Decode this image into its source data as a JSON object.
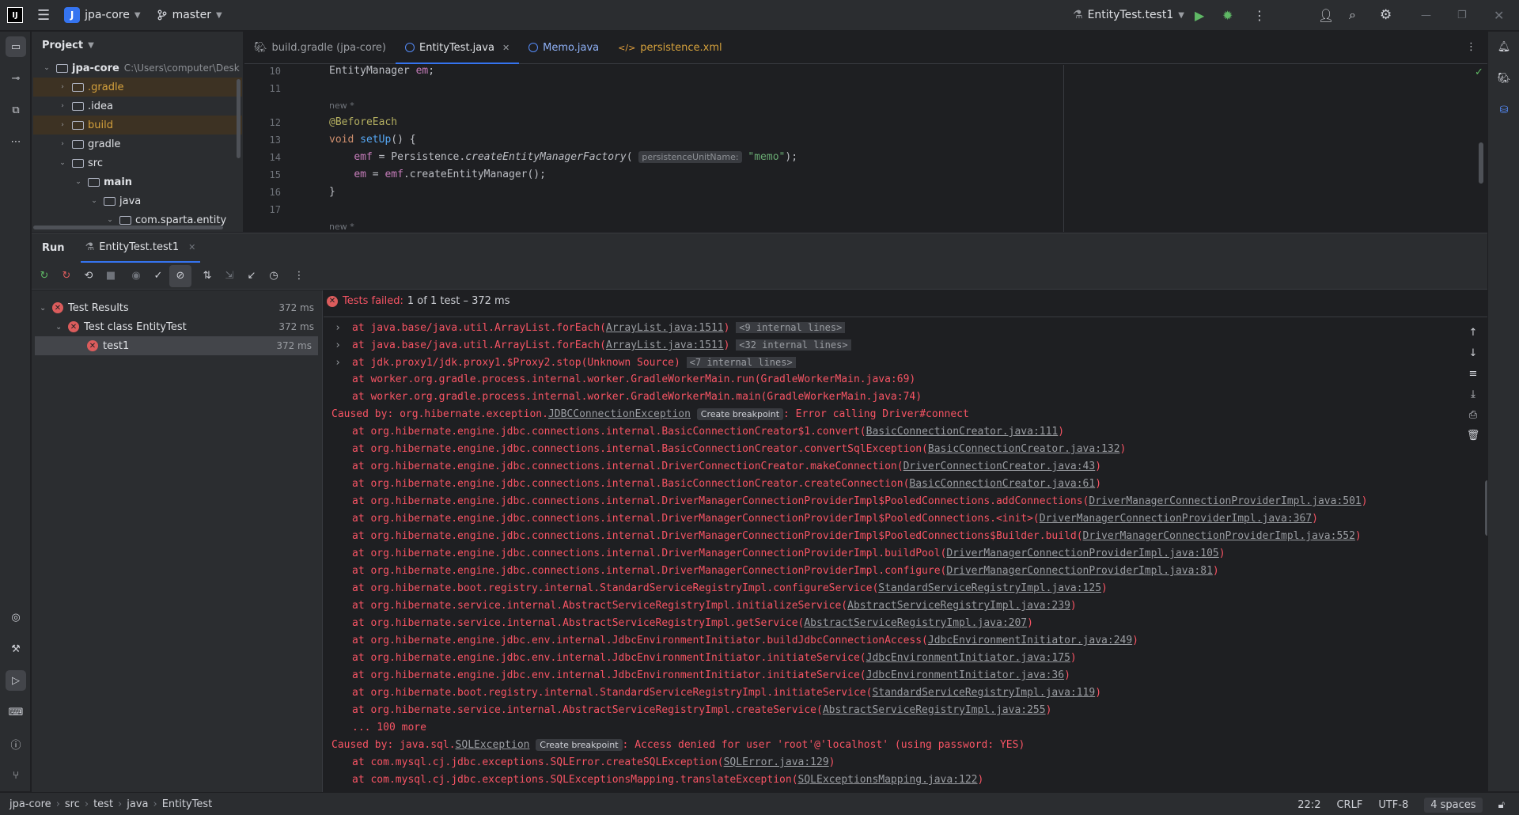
{
  "topbar": {
    "project_initial": "J",
    "project": "jpa-core",
    "branch": "master",
    "run_config": "EntityTest.test1"
  },
  "project_panel": {
    "title": "Project",
    "items": [
      {
        "label": "jpa-core",
        "path": "C:\\Users\\computer\\Desk",
        "indent": 0,
        "open": true,
        "color": "#dfe1e5",
        "bold": true
      },
      {
        "label": ".gradle",
        "indent": 1,
        "open": false,
        "color": "#d5a13c",
        "excluded": true
      },
      {
        "label": ".idea",
        "indent": 1,
        "open": false,
        "color": "#dfe1e5"
      },
      {
        "label": "build",
        "indent": 1,
        "open": false,
        "color": "#d5a13c",
        "excluded": true
      },
      {
        "label": "gradle",
        "indent": 1,
        "open": false,
        "color": "#dfe1e5"
      },
      {
        "label": "src",
        "indent": 1,
        "open": true,
        "color": "#dfe1e5"
      },
      {
        "label": "main",
        "indent": 2,
        "open": true,
        "color": "#dfe1e5",
        "bold": true
      },
      {
        "label": "java",
        "indent": 3,
        "open": true,
        "color": "#dfe1e5"
      },
      {
        "label": "com.sparta.entity",
        "indent": 4,
        "open": true,
        "color": "#dfe1e5"
      }
    ]
  },
  "editor": {
    "tabs": [
      {
        "label": "build.gradle (jpa-core)",
        "icon": "gradle-icon",
        "active": false
      },
      {
        "label": "EntityTest.java",
        "icon": "class-icon",
        "active": true,
        "closable": true
      },
      {
        "label": "Memo.java",
        "icon": "class-icon",
        "active": false
      },
      {
        "label": "persistence.xml",
        "icon": "xml-icon",
        "active": false
      }
    ],
    "hint_label": "persistenceUnitName:",
    "new_marker": "new *",
    "line_numbers": [
      "10",
      "11",
      "12",
      "13",
      "14",
      "15",
      "16",
      "17"
    ]
  },
  "run": {
    "tab_run": "Run",
    "tab_config": "EntityTest.test1",
    "status_prefix": "Tests failed:",
    "status_detail": "1 of 1 test – 372 ms",
    "tree": [
      {
        "label": "Test Results",
        "time": "372 ms",
        "indent": 0
      },
      {
        "label": "Test class EntityTest",
        "time": "372 ms",
        "indent": 1
      },
      {
        "label": "test1",
        "time": "372 ms",
        "indent": 2,
        "selected": true
      }
    ],
    "console": [
      {
        "pre": "at java.base/java.util.ArrayList.forEach(",
        "link": "ArrayList.java:1511",
        "post": ")",
        "tag": "<9 internal lines>",
        "expand": true
      },
      {
        "pre": "at java.base/java.util.ArrayList.forEach(",
        "link": "ArrayList.java:1511",
        "post": ")",
        "tag": "<32 internal lines>",
        "expand": true
      },
      {
        "pre": "at jdk.proxy1/jdk.proxy1.$Proxy2.stop(Unknown Source)",
        "tag": "<7 internal lines>",
        "expand": true
      },
      {
        "pre": "at worker.org.gradle.process.internal.worker.GradleWorkerMain.run(GradleWorkerMain.java:69)"
      },
      {
        "pre": "at worker.org.gradle.process.internal.worker.GradleWorkerMain.main(GradleWorkerMain.java:74)"
      },
      {
        "cause": true,
        "pre": "Caused by: org.hibernate.exception.",
        "link": "JDBCConnectionException",
        "bp": "Create breakpoint",
        "post": ": Error calling Driver#connect"
      },
      {
        "pre": "at org.hibernate.engine.jdbc.connections.internal.BasicConnectionCreator$1.convert(",
        "link": "BasicConnectionCreator.java:111",
        "post": ")"
      },
      {
        "pre": "at org.hibernate.engine.jdbc.connections.internal.BasicConnectionCreator.convertSqlException(",
        "link": "BasicConnectionCreator.java:132",
        "post": ")"
      },
      {
        "pre": "at org.hibernate.engine.jdbc.connections.internal.DriverConnectionCreator.makeConnection(",
        "link": "DriverConnectionCreator.java:43",
        "post": ")"
      },
      {
        "pre": "at org.hibernate.engine.jdbc.connections.internal.BasicConnectionCreator.createConnection(",
        "link": "BasicConnectionCreator.java:61",
        "post": ")"
      },
      {
        "pre": "at org.hibernate.engine.jdbc.connections.internal.DriverManagerConnectionProviderImpl$PooledConnections.addConnections(",
        "link": "DriverManagerConnectionProviderImpl.java:501",
        "post": ")"
      },
      {
        "pre": "at org.hibernate.engine.jdbc.connections.internal.DriverManagerConnectionProviderImpl$PooledConnections.<init>(",
        "link": "DriverManagerConnectionProviderImpl.java:367",
        "post": ")"
      },
      {
        "pre": "at org.hibernate.engine.jdbc.connections.internal.DriverManagerConnectionProviderImpl$PooledConnections$Builder.build(",
        "link": "DriverManagerConnectionProviderImpl.java:552",
        "post": ")"
      },
      {
        "pre": "at org.hibernate.engine.jdbc.connections.internal.DriverManagerConnectionProviderImpl.buildPool(",
        "link": "DriverManagerConnectionProviderImpl.java:105",
        "post": ")"
      },
      {
        "pre": "at org.hibernate.engine.jdbc.connections.internal.DriverManagerConnectionProviderImpl.configure(",
        "link": "DriverManagerConnectionProviderImpl.java:81",
        "post": ")"
      },
      {
        "pre": "at org.hibernate.boot.registry.internal.StandardServiceRegistryImpl.configureService(",
        "link": "StandardServiceRegistryImpl.java:125",
        "post": ")"
      },
      {
        "pre": "at org.hibernate.service.internal.AbstractServiceRegistryImpl.initializeService(",
        "link": "AbstractServiceRegistryImpl.java:239",
        "post": ")"
      },
      {
        "pre": "at org.hibernate.service.internal.AbstractServiceRegistryImpl.getService(",
        "link": "AbstractServiceRegistryImpl.java:207",
        "post": ")"
      },
      {
        "pre": "at org.hibernate.engine.jdbc.env.internal.JdbcEnvironmentInitiator.buildJdbcConnectionAccess(",
        "link": "JdbcEnvironmentInitiator.java:249",
        "post": ")"
      },
      {
        "pre": "at org.hibernate.engine.jdbc.env.internal.JdbcEnvironmentInitiator.initiateService(",
        "link": "JdbcEnvironmentInitiator.java:175",
        "post": ")"
      },
      {
        "pre": "at org.hibernate.engine.jdbc.env.internal.JdbcEnvironmentInitiator.initiateService(",
        "link": "JdbcEnvironmentInitiator.java:36",
        "post": ")"
      },
      {
        "pre": "at org.hibernate.boot.registry.internal.StandardServiceRegistryImpl.initiateService(",
        "link": "StandardServiceRegistryImpl.java:119",
        "post": ")"
      },
      {
        "pre": "at org.hibernate.service.internal.AbstractServiceRegistryImpl.createService(",
        "link": "AbstractServiceRegistryImpl.java:255",
        "post": ")"
      },
      {
        "pre": "... 100 more"
      },
      {
        "cause": true,
        "pre": "Caused by: java.sql.",
        "link": "SQLException",
        "bp": "Create breakpoint",
        "post": ": Access denied for user 'root'@'localhost' (using password: YES)"
      },
      {
        "pre": "at com.mysql.cj.jdbc.exceptions.SQLError.createSQLException(",
        "link": "SQLError.java:129",
        "post": ")"
      },
      {
        "pre": "at com.mysql.cj.jdbc.exceptions.SQLExceptionsMapping.translateException(",
        "link": "SQLExceptionsMapping.java:122",
        "post": ")"
      }
    ]
  },
  "statusbar": {
    "crumbs": [
      "jpa-core",
      "src",
      "test",
      "java",
      "EntityTest"
    ],
    "position": "22:2",
    "line_ending": "CRLF",
    "encoding": "UTF-8",
    "indent": "4 spaces"
  }
}
